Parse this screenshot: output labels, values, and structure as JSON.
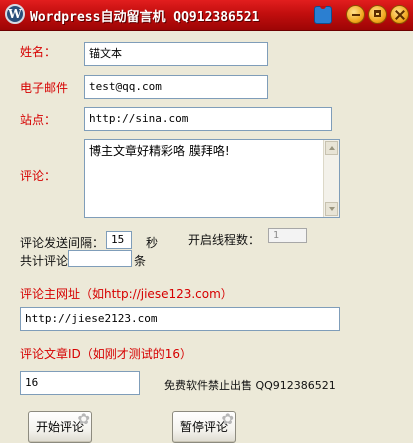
{
  "window": {
    "title": "Wordpress自动留言机 QQ912386521"
  },
  "form": {
    "name": {
      "label": "姓名：",
      "value": "锚文本"
    },
    "email": {
      "label": "电子邮件",
      "value": "test@qq.com"
    },
    "site": {
      "label": "站点：",
      "value": "http://sina.com"
    },
    "comment": {
      "label": "评论：",
      "value": "博主文章好精彩咯 膜拜咯!"
    }
  },
  "settings": {
    "interval_label": "评论发送间隔：",
    "interval_value": "15",
    "interval_unit": "秒",
    "threads_label": "开启线程数：",
    "threads_value": "1",
    "total_label": "共计评论",
    "total_value": "",
    "total_unit": "条"
  },
  "target": {
    "url_label": "评论主网址（如http://jiese123.com）",
    "url_value": "http://jiese2123.com",
    "post_id_label": "评论文章ID（如刚才测试的16）",
    "post_id_value": "16"
  },
  "notice": "免费软件禁止出售 QQ912386521",
  "buttons": {
    "start": "开始评论",
    "pause": "暂停评论"
  },
  "icons": {
    "title_logo": "wordpress-logo-icon",
    "skin": "shirt-icon",
    "minimize": "minimize-icon",
    "maximize": "maximize-icon",
    "close": "close-icon"
  },
  "colors": {
    "titlebar": "#c20e0e",
    "label_red": "#d60000",
    "background": "#ece9d8"
  }
}
